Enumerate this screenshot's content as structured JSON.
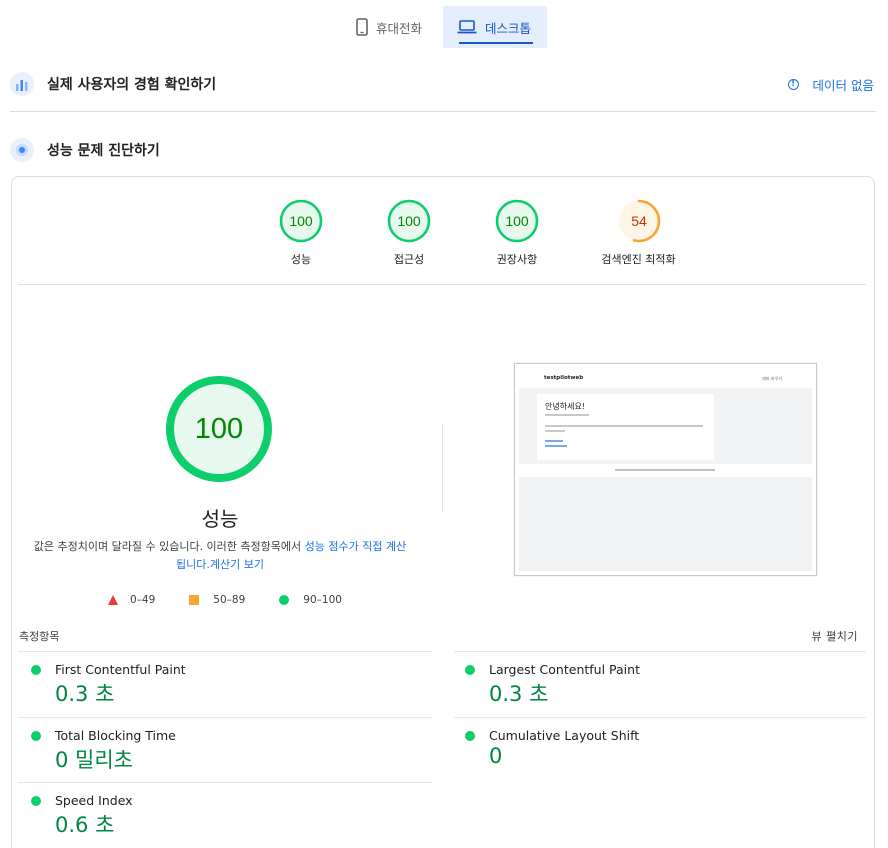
{
  "device_tabs": [
    {
      "label": "휴대전화",
      "icon": "phone-icon",
      "active": false
    },
    {
      "label": "데스크톱",
      "icon": "laptop-icon",
      "active": true
    }
  ],
  "field_section": {
    "title": "실제 사용자의 경험 확인하기",
    "no_data": "데이터 없음"
  },
  "diagnose_section": {
    "title": "성능 문제 진단하기"
  },
  "gauges": [
    {
      "score": "100",
      "label": "성능",
      "color": "#0cce6b"
    },
    {
      "score": "100",
      "label": "접근성",
      "color": "#0cce6b"
    },
    {
      "score": "100",
      "label": "권장사항",
      "color": "#0cce6b"
    },
    {
      "score": "54",
      "label": "검색엔진 최적화",
      "color": "#f7a534"
    }
  ],
  "main_score": {
    "score": "100",
    "label": "성능",
    "color": "#0cce6b"
  },
  "description": {
    "text": "값은 추정치이며 달라질 수 있습니다. 이러한 측정항목에서 ",
    "link1": "성능 점수가 직접 계산됩니다.",
    "link2": "계산기 보기"
  },
  "legend": [
    {
      "shape": "triangle",
      "range": "0–49",
      "color": "#eb3b34"
    },
    {
      "shape": "square",
      "range": "50–89",
      "color": "#f7a534"
    },
    {
      "shape": "circle",
      "range": "90–100",
      "color": "#0cce6b"
    }
  ],
  "screenshot": {
    "brand": "testpilotweb",
    "menu": "테마 바꾸기",
    "heading": "안녕하세요!"
  },
  "metrics_header": {
    "title": "측정항목",
    "expand": "뷰 펼치기"
  },
  "metrics": [
    {
      "name": "First Contentful Paint",
      "value": "0.3 초"
    },
    {
      "name": "Largest Contentful Paint",
      "value": "0.3 초"
    },
    {
      "name": "Total Blocking Time",
      "value": "0 밀리초"
    },
    {
      "name": "Cumulative Layout Shift",
      "value": "0"
    },
    {
      "name": "Speed Index",
      "value": "0.6 초"
    }
  ]
}
